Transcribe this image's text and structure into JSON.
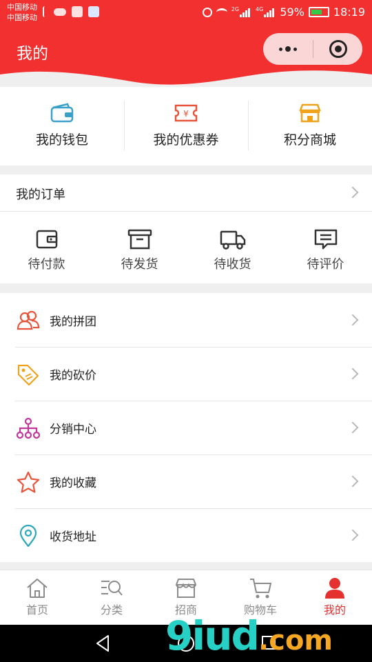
{
  "status_bar": {
    "carrier1": "中国移动",
    "carrier2": "中国移动",
    "net1": "2G",
    "net2": "4G",
    "battery": "59%",
    "time": "18:19"
  },
  "header": {
    "title": "我的"
  },
  "quick_links": [
    {
      "label": "我的钱包",
      "icon": "wallet-icon",
      "color": "#3aa0c8"
    },
    {
      "label": "我的优惠券",
      "icon": "coupon-icon",
      "color": "#e8533a"
    },
    {
      "label": "积分商城",
      "icon": "store-icon",
      "color": "#f0a21a"
    }
  ],
  "orders": {
    "title": "我的订单",
    "items": [
      {
        "label": "待付款",
        "icon": "wallet-pay-icon"
      },
      {
        "label": "待发货",
        "icon": "box-icon"
      },
      {
        "label": "待收货",
        "icon": "truck-icon"
      },
      {
        "label": "待评价",
        "icon": "comment-icon"
      }
    ]
  },
  "menu": [
    {
      "label": "我的拼团",
      "icon": "group-icon",
      "color": "#e8533a"
    },
    {
      "label": "我的砍价",
      "icon": "tag-icon",
      "color": "#f0a21a"
    },
    {
      "label": "分销中心",
      "icon": "network-icon",
      "color": "#c0399a"
    },
    {
      "label": "我的收藏",
      "icon": "star-icon",
      "color": "#e8533a"
    },
    {
      "label": "收货地址",
      "icon": "location-icon",
      "color": "#2aa7b8"
    }
  ],
  "tabbar": [
    {
      "label": "首页",
      "icon": "home-icon"
    },
    {
      "label": "分类",
      "icon": "category-search-icon"
    },
    {
      "label": "招商",
      "icon": "shop-icon"
    },
    {
      "label": "购物车",
      "icon": "cart-icon"
    },
    {
      "label": "我的",
      "icon": "user-icon",
      "active": true
    }
  ],
  "watermark": {
    "part1": "9iud",
    "part2": ".com"
  },
  "colors": {
    "brand_red": "#f23030",
    "active_tab": "#e53030"
  }
}
